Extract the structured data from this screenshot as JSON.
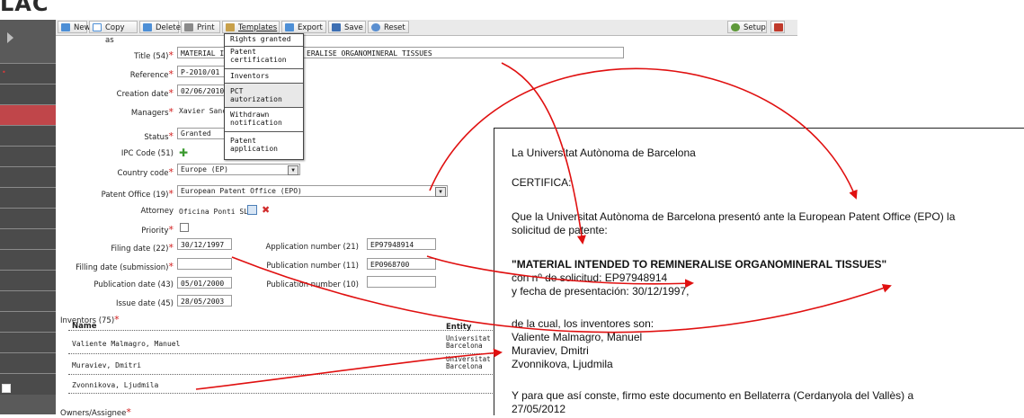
{
  "app": {
    "logo_text": "LAC"
  },
  "toolbar": {
    "new_label": "New",
    "copy_as_label": "Copy as",
    "delete_label": "Delete",
    "print_label": "Print",
    "templates_label": "Templates",
    "export_label": "Export",
    "save_label": "Save",
    "reset_label": "Reset",
    "setup_label": "Setup"
  },
  "templates_menu": {
    "items": [
      "Rights granted",
      "Patent\ncertification",
      "Inventors",
      "PCT\nautorization",
      "Withdrawn\nnotification",
      "Patent\napplication"
    ]
  },
  "form": {
    "title": {
      "label": "Title (54)",
      "value": "MATERIAL INTENDED TO REMINERALISE ORGANOMINERAL TISSUES",
      "shown_prefix": "MATERIAL I",
      "shown_suffix": "ERALISE ORGANOMINERAL TISSUES"
    },
    "reference": {
      "label": "Reference",
      "value": "P-2010/01"
    },
    "creation_date": {
      "label": "Creation date",
      "value": "02/06/2010"
    },
    "managers": {
      "label": "Managers",
      "value": "Xavier Sanc"
    },
    "status": {
      "label": "Status",
      "value": "Granted"
    },
    "ipc_code": {
      "label": "IPC Code (51)"
    },
    "country_code": {
      "label": "Country code",
      "value": "Europe (EP)"
    },
    "patent_office": {
      "label": "Patent Office (19)",
      "value": "European Patent Office (EPO)"
    },
    "attorney": {
      "label": "Attorney",
      "value": "Oficina Ponti SL"
    },
    "priority": {
      "label": "Priority"
    },
    "filing_date": {
      "label": "Filing date (22)",
      "value": "30/12/1997"
    },
    "filling_date_submission": {
      "label": "Filling date (submission)",
      "value": ""
    },
    "publication_date": {
      "label": "Publication date (43)",
      "value": "05/01/2000"
    },
    "issue_date": {
      "label": "Issue date (45)",
      "value": "28/05/2003"
    },
    "application_number": {
      "label": "Application number (21)",
      "value": "EP97948914"
    },
    "publication_number_11": {
      "label": "Publication number (11)",
      "value": "EP0968700"
    },
    "publication_number_10": {
      "label": "Publication number (10)",
      "value": ""
    },
    "inventors_label": "Inventors (75)",
    "inventors_col_name": "Name",
    "inventors_col_entity": "Entity",
    "inventors": [
      {
        "name": "Valiente Malmagro, Manuel",
        "entity": "Universitat\nBarcelona"
      },
      {
        "name": "Muraviev, Dmitri",
        "entity": "Universitat\nBarcelona"
      },
      {
        "name": "Zvonnikova, Ljudmila",
        "entity": ""
      }
    ],
    "next_section_label": "Owners/Assignee"
  },
  "certificate": {
    "line1": "La Universitat Autònoma de Barcelona",
    "line2": "CERTIFICA:",
    "line3a": "Que la Universitat Autònoma de Barcelona presentó ante la European Patent Office (EPO) la",
    "line3b": "solicitud de patente:",
    "title": "\"MATERIAL INTENDED TO REMINERALISE ORGANOMINERAL TISSUES\"",
    "line5": "con nº de solicitud: EP97948914",
    "line6": "y fecha de presentación: 30/12/1997,",
    "line7": "de la cual, los inventores son:",
    "inv1": "Valiente Malmagro, Manuel",
    "inv2": "Muraviev, Dmitri",
    "inv3": "Zvonnikova, Ljudmila",
    "line8": "Y para que así conste, firmo este documento en Bellaterra (Cerdanyola del Vallès) a",
    "line9": "27/05/2012"
  },
  "colors": {
    "required": "#d21d1d",
    "arrow": "#e01010",
    "sidebar_active": "#c0464a"
  }
}
